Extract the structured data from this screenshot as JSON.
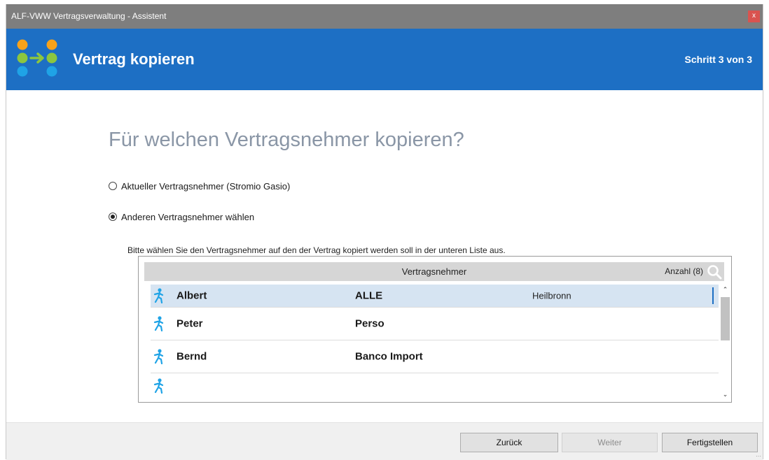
{
  "window": {
    "title": "ALF-VWW Vertragsverwaltung - Assistent",
    "close_label": "x"
  },
  "header": {
    "title": "Vertrag kopieren",
    "step": "Schritt 3 von 3"
  },
  "main": {
    "question": "Für welchen Vertragsnehmer kopieren?",
    "options": [
      {
        "label": "Aktueller Vertragsnehmer (Stromio  Gasio)",
        "selected": false
      },
      {
        "label": "Anderen Vertragsnehmer wählen",
        "selected": true
      }
    ],
    "hint": "Bitte wählen Sie den Vertragsnehmer auf den der Vertrag kopiert werden soll in der unteren Liste aus."
  },
  "list": {
    "column": "Vertragsnehmer",
    "count": "Anzahl (8)",
    "rows": [
      {
        "first": "Albert",
        "last": "ALLE",
        "city": "Heilbronn",
        "selected": true
      },
      {
        "first": "Peter",
        "last": "Perso",
        "city": ""
      },
      {
        "first": "Bernd",
        "last": "Banco Import",
        "city": ""
      },
      {
        "first": "",
        "last": "",
        "city": ""
      }
    ]
  },
  "footer": {
    "back": "Zurück",
    "next": "Weiter",
    "finish": "Fertigstellen"
  },
  "colors": {
    "accent": "#1d6fc4",
    "titlebar": "#7e7e7e",
    "close": "#d9534f",
    "selection": "#d6e4f2",
    "icon": "#1fa3e6"
  }
}
